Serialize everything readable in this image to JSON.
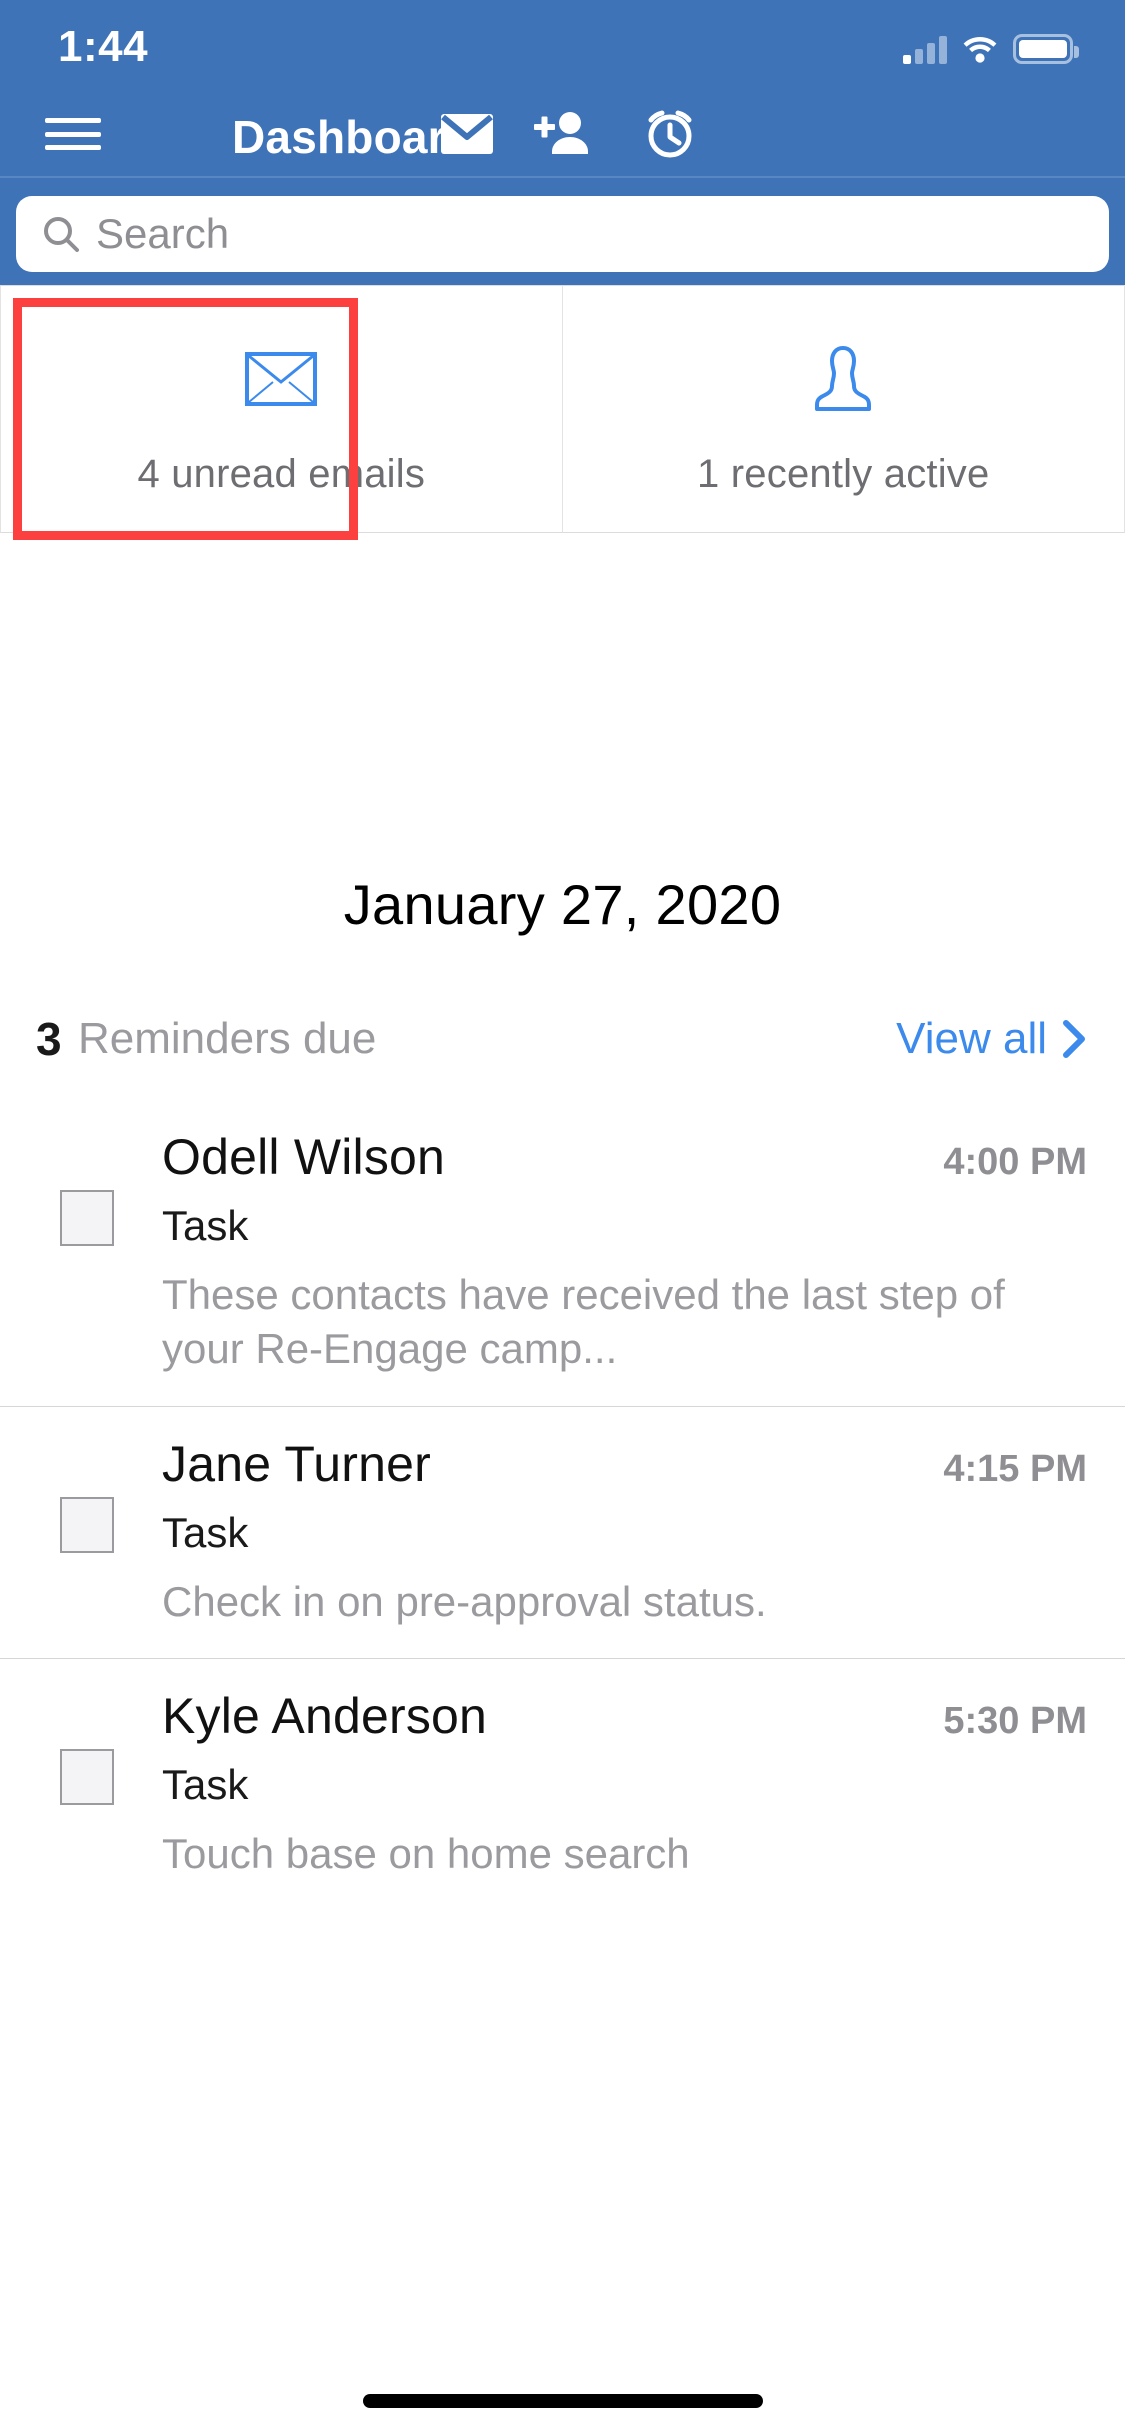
{
  "status_bar": {
    "time": "1:44",
    "signal_icon": "cellular-signal-icon",
    "wifi_icon": "wifi-icon",
    "battery_icon": "battery-full-icon"
  },
  "nav": {
    "menu_icon": "hamburger-menu-icon",
    "title": "Dashboard",
    "mail_icon": "mail-icon",
    "add_person_icon": "add-person-icon",
    "alarm_icon": "alarm-clock-icon"
  },
  "search": {
    "placeholder": "Search",
    "value": "",
    "icon": "search-icon"
  },
  "cards": [
    {
      "icon": "envelope-outline-icon",
      "label": "4 unread emails",
      "count": 4,
      "highlighted": true
    },
    {
      "icon": "person-outline-icon",
      "label": "1 recently active",
      "count": 1,
      "highlighted": false
    }
  ],
  "date_title": "January 27, 2020",
  "reminders_header": {
    "count": "3",
    "label": "Reminders due",
    "view_all_label": "View all",
    "chevron_icon": "chevron-right-icon"
  },
  "reminders": [
    {
      "name": "Odell Wilson",
      "time": "4:00 PM",
      "type": "Task",
      "description": "These contacts have received the last step of your Re-Engage camp...",
      "checkbox": "unchecked"
    },
    {
      "name": "Jane Turner",
      "time": "4:15 PM",
      "type": "Task",
      "description": "Check in on pre-approval status.",
      "checkbox": "unchecked"
    },
    {
      "name": "Kyle Anderson",
      "time": "5:30 PM",
      "type": "Task",
      "description": "Touch base on home search",
      "checkbox": "unchecked"
    }
  ],
  "colors": {
    "header_blue": "#3f73b8",
    "accent_blue": "#3b8aec",
    "highlight_red": "#fc4040",
    "muted_text": "#9b9b9f"
  },
  "home_indicator": "home-indicator"
}
